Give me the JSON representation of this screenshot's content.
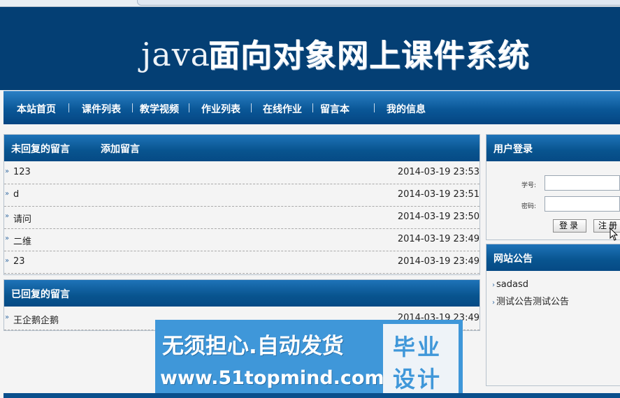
{
  "banner": {
    "title_prefix": "java",
    "title_main": "面向对象网上课件系统"
  },
  "nav": {
    "items": [
      "本站首页",
      "课件列表",
      "教学视频",
      "作业列表",
      "在线作业",
      "留言本",
      "我的信息"
    ]
  },
  "unreplied": {
    "tab_unreplied": "未回复的留言",
    "tab_add": "添加留言",
    "rows": [
      {
        "text": "123",
        "time": "2014-03-19 23:53"
      },
      {
        "text": "d",
        "time": "2014-03-19 23:51"
      },
      {
        "text": "请问",
        "time": "2014-03-19 23:50"
      },
      {
        "text": "二维",
        "time": "2014-03-19 23:49"
      },
      {
        "text": "23",
        "time": "2014-03-19 23:49"
      }
    ]
  },
  "replied": {
    "title": "已回复的留言",
    "rows": [
      {
        "text": "王企鹅企鹅",
        "time": "2014-03-19 23:49"
      }
    ]
  },
  "login": {
    "title": "用户登录",
    "username_label": "学号:",
    "password_label": "密码:",
    "username_value": "",
    "password_value": "",
    "login_button": "登录",
    "register_button": "注册"
  },
  "notice": {
    "title": "网站公告",
    "items": [
      "sadasd",
      "测试公告测试公告"
    ]
  },
  "watermark": {
    "line1": "无须担心.自动发货",
    "line2": "www.51topmind.com",
    "badge_line1": "毕业",
    "badge_line2": "设计"
  }
}
